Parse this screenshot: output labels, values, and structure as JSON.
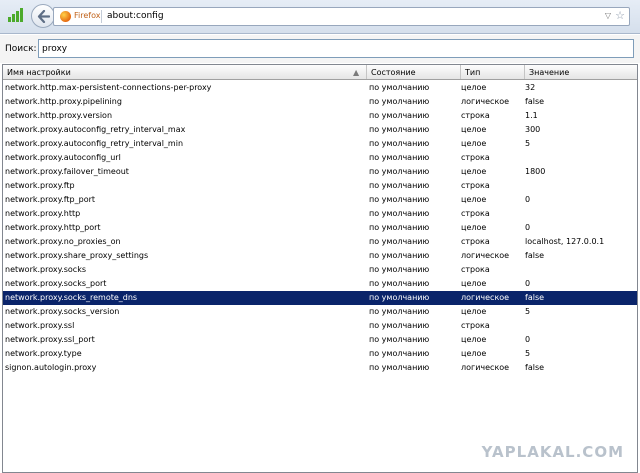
{
  "toolbar": {
    "brand": "Firefox",
    "url": "about:config",
    "dropdown_icon": "chevron-down",
    "star_icon": "star"
  },
  "search": {
    "label": "Поиск:",
    "value": "proxy"
  },
  "table": {
    "columns": [
      "Имя настройки",
      "Состояние",
      "Тип",
      "Значение"
    ],
    "rows": [
      [
        "network.http.max-persistent-connections-per-proxy",
        "по умолчанию",
        "целое",
        "32"
      ],
      [
        "network.http.proxy.pipelining",
        "по умолчанию",
        "логическое",
        "false"
      ],
      [
        "network.http.proxy.version",
        "по умолчанию",
        "строка",
        "1.1"
      ],
      [
        "network.proxy.autoconfig_retry_interval_max",
        "по умолчанию",
        "целое",
        "300"
      ],
      [
        "network.proxy.autoconfig_retry_interval_min",
        "по умолчанию",
        "целое",
        "5"
      ],
      [
        "network.proxy.autoconfig_url",
        "по умолчанию",
        "строка",
        ""
      ],
      [
        "network.proxy.failover_timeout",
        "по умолчанию",
        "целое",
        "1800"
      ],
      [
        "network.proxy.ftp",
        "по умолчанию",
        "строка",
        ""
      ],
      [
        "network.proxy.ftp_port",
        "по умолчанию",
        "целое",
        "0"
      ],
      [
        "network.proxy.http",
        "по умолчанию",
        "строка",
        ""
      ],
      [
        "network.proxy.http_port",
        "по умолчанию",
        "целое",
        "0"
      ],
      [
        "network.proxy.no_proxies_on",
        "по умолчанию",
        "строка",
        "localhost, 127.0.0.1"
      ],
      [
        "network.proxy.share_proxy_settings",
        "по умолчанию",
        "логическое",
        "false"
      ],
      [
        "network.proxy.socks",
        "по умолчанию",
        "строка",
        ""
      ],
      [
        "network.proxy.socks_port",
        "по умолчанию",
        "целое",
        "0"
      ],
      [
        "network.proxy.socks_remote_dns",
        "по умолчанию",
        "логическое",
        "false"
      ],
      [
        "network.proxy.socks_version",
        "по умолчанию",
        "целое",
        "5"
      ],
      [
        "network.proxy.ssl",
        "по умолчанию",
        "строка",
        ""
      ],
      [
        "network.proxy.ssl_port",
        "по умолчанию",
        "целое",
        "0"
      ],
      [
        "network.proxy.type",
        "по умолчанию",
        "целое",
        "5"
      ],
      [
        "signon.autologin.proxy",
        "по умолчанию",
        "логическое",
        "false"
      ]
    ],
    "selected_index": 15,
    "selected_color": "#0a246a"
  },
  "watermark": "YAPLAKAL.COM"
}
